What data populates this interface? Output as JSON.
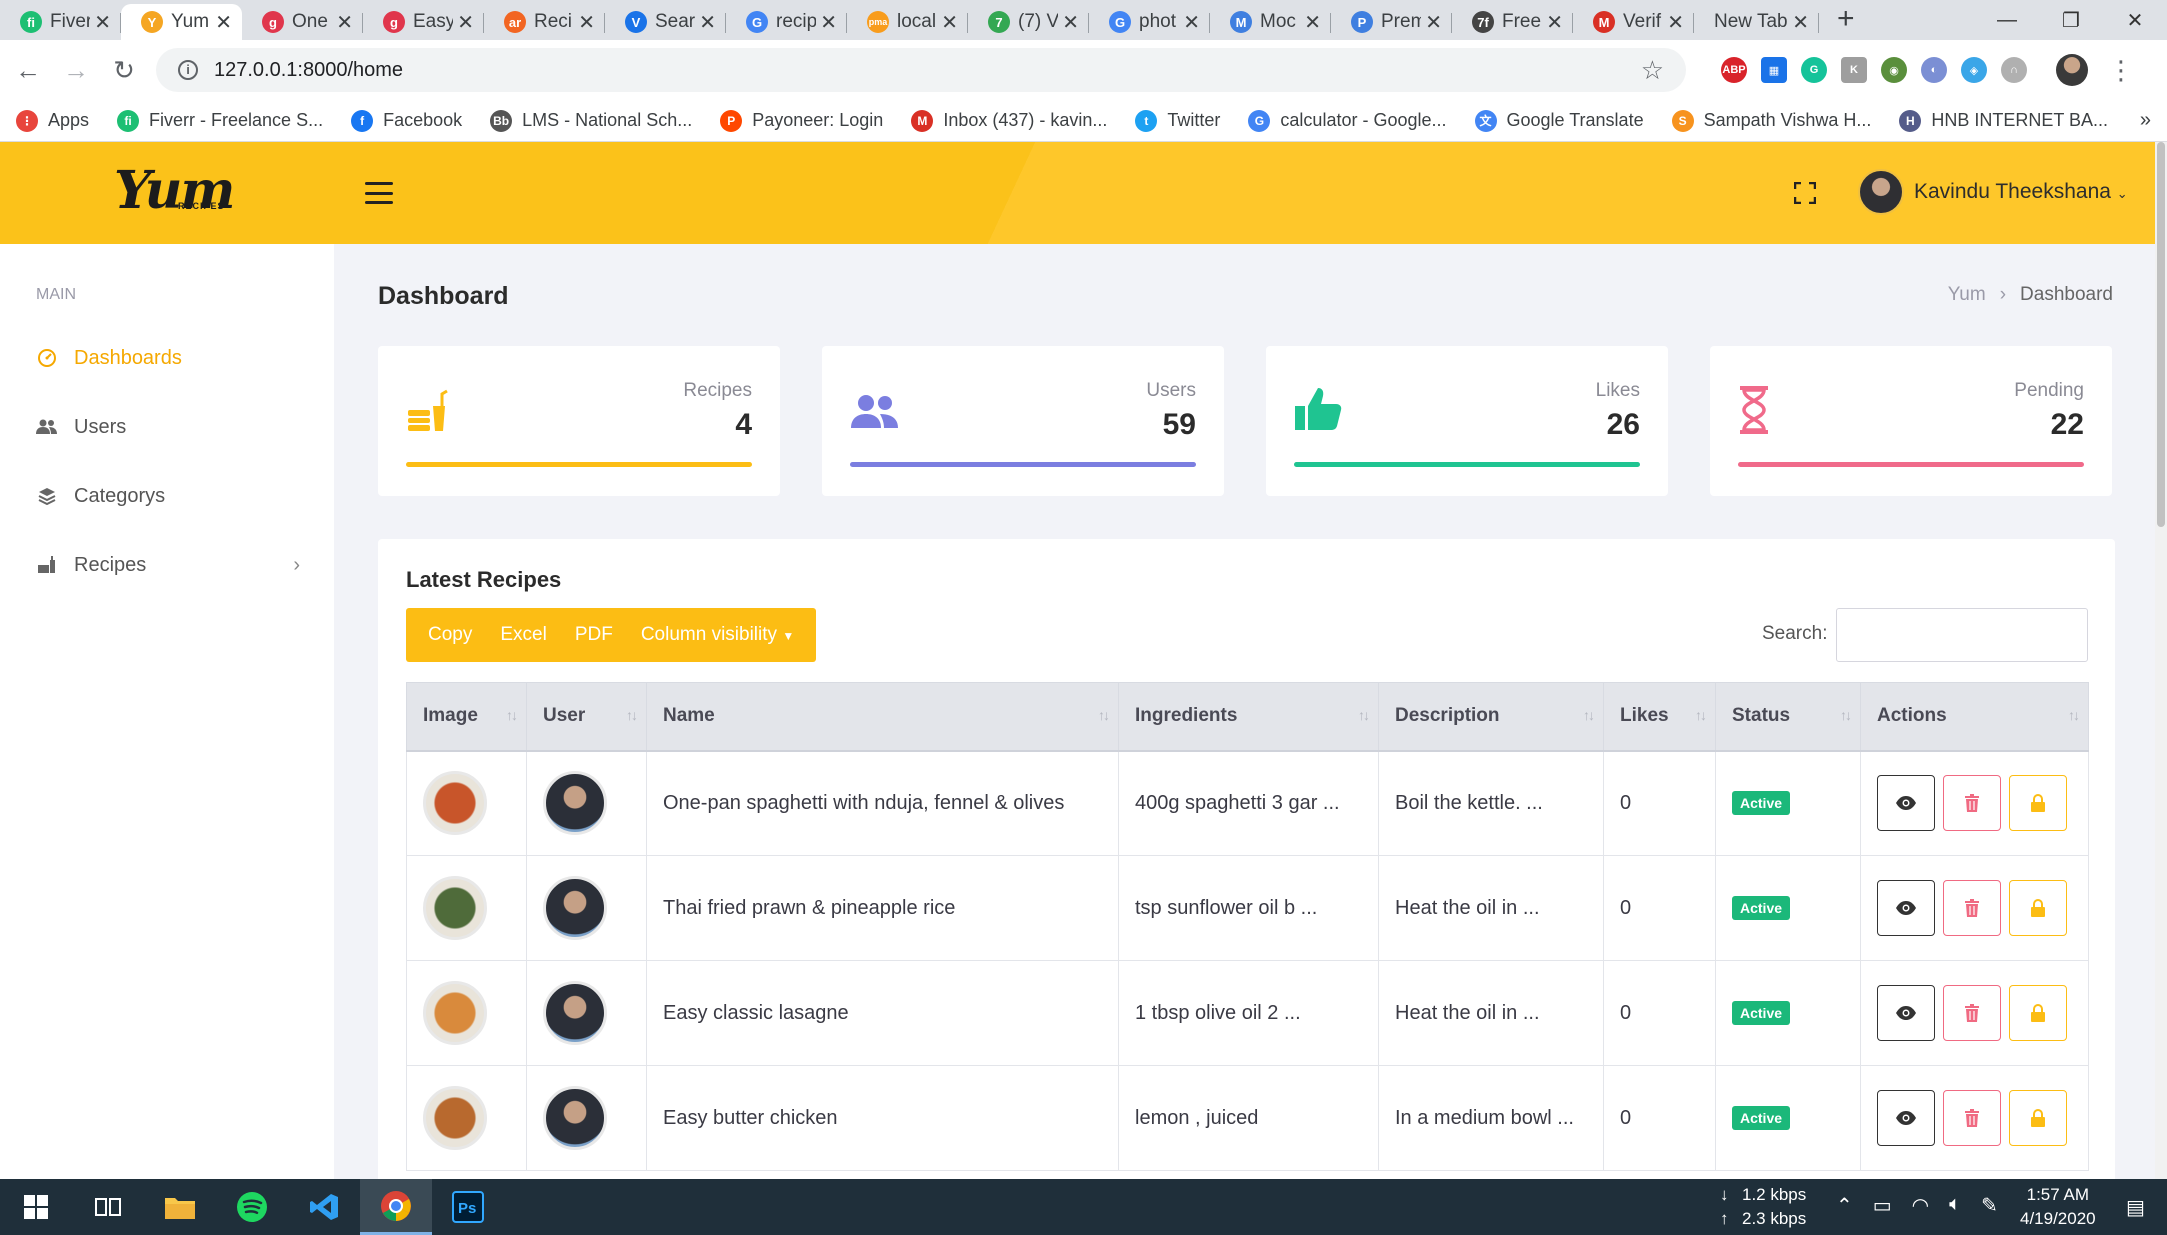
{
  "browser": {
    "tabs": [
      {
        "label": "Fiverr",
        "color": "#1dbf73",
        "glyph": "fi",
        "active": false
      },
      {
        "label": "Yum",
        "color": "#f5a623",
        "glyph": "Y",
        "active": true
      },
      {
        "label": "One",
        "color": "#e0364c",
        "glyph": "g",
        "active": false
      },
      {
        "label": "Easy",
        "color": "#e0364c",
        "glyph": "g",
        "active": false
      },
      {
        "label": "Reci",
        "color": "#f26522",
        "glyph": "ar",
        "active": false
      },
      {
        "label": "Sear",
        "color": "#1a73e8",
        "glyph": "V",
        "active": false
      },
      {
        "label": "recip",
        "color": "#4285f4",
        "glyph": "G",
        "active": false
      },
      {
        "label": "local",
        "color": "#f89c1c",
        "glyph": "pma",
        "active": false
      },
      {
        "label": "(7) V",
        "color": "#34a853",
        "glyph": "7",
        "active": false
      },
      {
        "label": "phot",
        "color": "#4285f4",
        "glyph": "G",
        "active": false
      },
      {
        "label": "Moc",
        "color": "#3f7fe0",
        "glyph": "M",
        "active": false
      },
      {
        "label": "Prem",
        "color": "#3f7fe0",
        "glyph": "P",
        "active": false
      },
      {
        "label": "Free",
        "color": "#444444",
        "glyph": "7f",
        "active": false
      },
      {
        "label": "Verif",
        "color": "#d93025",
        "glyph": "M",
        "active": false
      }
    ],
    "new_tab_label": "New Tab",
    "url": "127.0.0.1:8000/home",
    "bookmarks": [
      {
        "label": "Apps",
        "color": "#e8453c",
        "glyph": "⋮"
      },
      {
        "label": "Fiverr - Freelance S...",
        "color": "#1dbf73",
        "glyph": "fi"
      },
      {
        "label": "Facebook",
        "color": "#1877f2",
        "glyph": "f"
      },
      {
        "label": "LMS - National Sch...",
        "color": "#555555",
        "glyph": "Bb"
      },
      {
        "label": "Payoneer: Login",
        "color": "#ff4800",
        "glyph": "P"
      },
      {
        "label": "Inbox (437) - kavin...",
        "color": "#d93025",
        "glyph": "M"
      },
      {
        "label": "Twitter",
        "color": "#1da1f2",
        "glyph": "t"
      },
      {
        "label": "calculator - Google...",
        "color": "#4285f4",
        "glyph": "G"
      },
      {
        "label": "Google Translate",
        "color": "#4285f4",
        "glyph": "文"
      },
      {
        "label": "Sampath Vishwa H...",
        "color": "#f7931e",
        "glyph": "S"
      },
      {
        "label": "HNB INTERNET BA...",
        "color": "#555c8a",
        "glyph": "H"
      }
    ]
  },
  "header": {
    "logo_text": "Yum",
    "logo_sub": "RECIPES",
    "user_name": "Kavindu Theekshana"
  },
  "sidebar": {
    "section": "MAIN",
    "items": [
      {
        "label": "Dashboards",
        "icon": "dashboard-icon",
        "active": true
      },
      {
        "label": "Users",
        "icon": "users-icon",
        "active": false
      },
      {
        "label": "Categorys",
        "icon": "layers-icon",
        "active": false
      },
      {
        "label": "Recipes",
        "icon": "recipes-icon",
        "active": false
      }
    ]
  },
  "page": {
    "title": "Dashboard",
    "breadcrumb": [
      "Yum",
      "Dashboard"
    ]
  },
  "stats": [
    {
      "label": "Recipes",
      "value": "4",
      "color": "#fcbd14",
      "icon": "food-icon"
    },
    {
      "label": "Users",
      "value": "59",
      "color": "#7b7ee0",
      "icon": "users-icon"
    },
    {
      "label": "Likes",
      "value": "26",
      "color": "#1fc491",
      "icon": "thumbs-up-icon"
    },
    {
      "label": "Pending",
      "value": "22",
      "color": "#f06a8a",
      "icon": "hourglass-icon"
    }
  ],
  "recipes_table": {
    "title": "Latest Recipes",
    "buttons": [
      "Copy",
      "Excel",
      "PDF",
      "Column visibility"
    ],
    "search_label": "Search:",
    "columns": [
      "Image",
      "User",
      "Name",
      "Ingredients",
      "Description",
      "Likes",
      "Status",
      "Actions"
    ],
    "rows": [
      {
        "name": "One-pan spaghetti with nduja, fennel & olives",
        "ingredients": "400g spaghetti 3 gar ...",
        "description": "Boil the kettle. ...",
        "likes": "0",
        "status": "Active",
        "food_color": "#c8552a"
      },
      {
        "name": "Thai fried prawn & pineapple rice",
        "ingredients": "tsp sunflower oil b ...",
        "description": "Heat the oil in ...",
        "likes": "0",
        "status": "Active",
        "food_color": "#4f6b3a"
      },
      {
        "name": "Easy classic lasagne",
        "ingredients": "1 tbsp olive oil 2 ...",
        "description": "Heat the oil in ...",
        "likes": "0",
        "status": "Active",
        "food_color": "#d98a3c"
      },
      {
        "name": "Easy butter chicken",
        "ingredients": "lemon , juiced",
        "description": "In a medium bowl ...",
        "likes": "0",
        "status": "Active",
        "food_color": "#b8692e"
      }
    ]
  },
  "taskbar": {
    "net_down": "1.2 kbps",
    "net_up": "2.3 kbps",
    "time": "1:57 AM",
    "date": "4/19/2020"
  }
}
